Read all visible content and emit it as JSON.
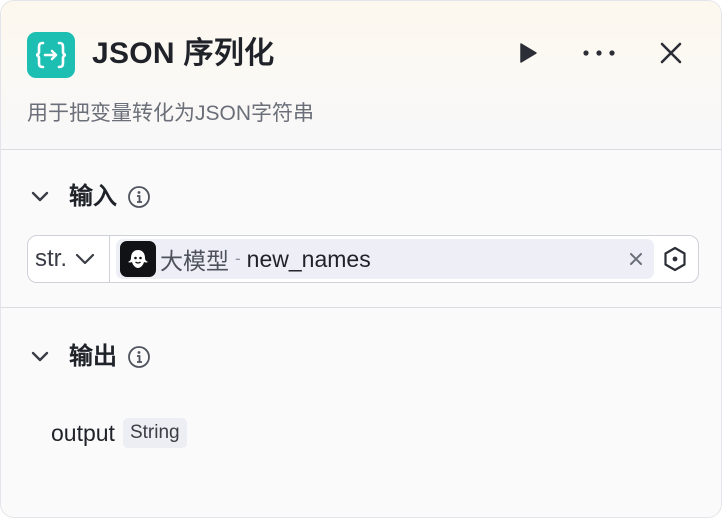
{
  "node": {
    "title": "JSON 序列化",
    "description": "用于把变量转化为JSON字符串",
    "icon": "braces-arrow-icon",
    "accent_color": "#1dbfb3"
  },
  "header_actions": [
    "run-icon",
    "more-icon",
    "close-icon"
  ],
  "input": {
    "title": "输入",
    "param": {
      "type": "str.",
      "source_node": "大模型",
      "separator": "-",
      "variable": "new_names"
    }
  },
  "output": {
    "title": "输出",
    "field": {
      "name": "output",
      "type": "String"
    }
  }
}
